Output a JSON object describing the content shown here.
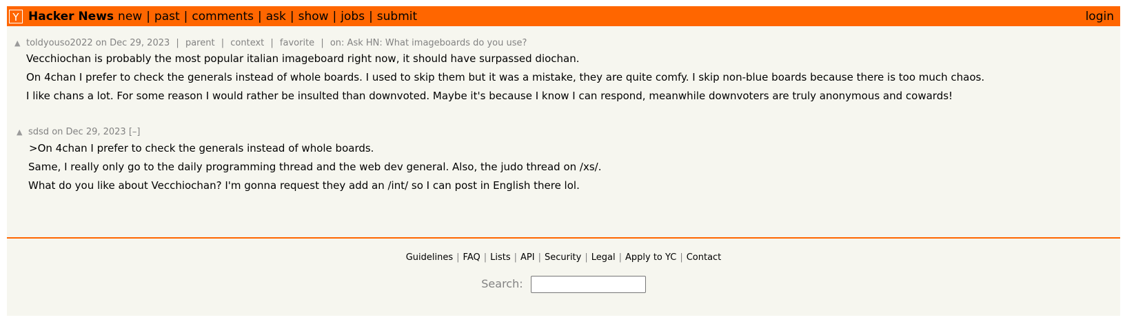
{
  "header": {
    "logo_letter": "Y",
    "site_name": "Hacker News",
    "nav": [
      "new",
      "past",
      "comments",
      "ask",
      "show",
      "jobs",
      "submit"
    ],
    "login": "login",
    "accent_color": "#ff6600"
  },
  "comments": [
    {
      "vote_icon": "upvote-arrow-icon",
      "user": "toldyouso2022",
      "time": "on Dec 29, 2023",
      "links": [
        "parent",
        "context",
        "favorite"
      ],
      "story": "on: Ask HN: What imageboards do you use?",
      "paragraphs": [
        "Vecchiochan is probably the most popular italian imageboard right now, it should have surpassed diochan.",
        "On 4chan I prefer to check the generals instead of whole boards. I used to skip them but it was a mistake, they are quite comfy. I skip non-blue boards because there is too much chaos.",
        "I like chans a lot. For some reason I would rather be insulted than downvoted. Maybe it's because I know I can respond, meanwhile downvoters are truly anonymous and cowards!"
      ]
    },
    {
      "vote_icon": "upvote-arrow-icon",
      "user": "sdsd",
      "time": "on Dec 29, 2023",
      "toggle": "[–]",
      "paragraphs": [
        ">On 4chan I prefer to check the generals instead of whole boards.",
        "Same, I really only go to the daily programming thread and the web dev general. Also, the judo thread on /xs/.",
        "What do you like about Vecchiochan? I'm gonna request they add an /int/ so I can post in English there lol."
      ]
    }
  ],
  "footer": {
    "links": [
      "Guidelines",
      "FAQ",
      "Lists",
      "API",
      "Security",
      "Legal",
      "Apply to YC",
      "Contact"
    ],
    "search_label": "Search:"
  }
}
